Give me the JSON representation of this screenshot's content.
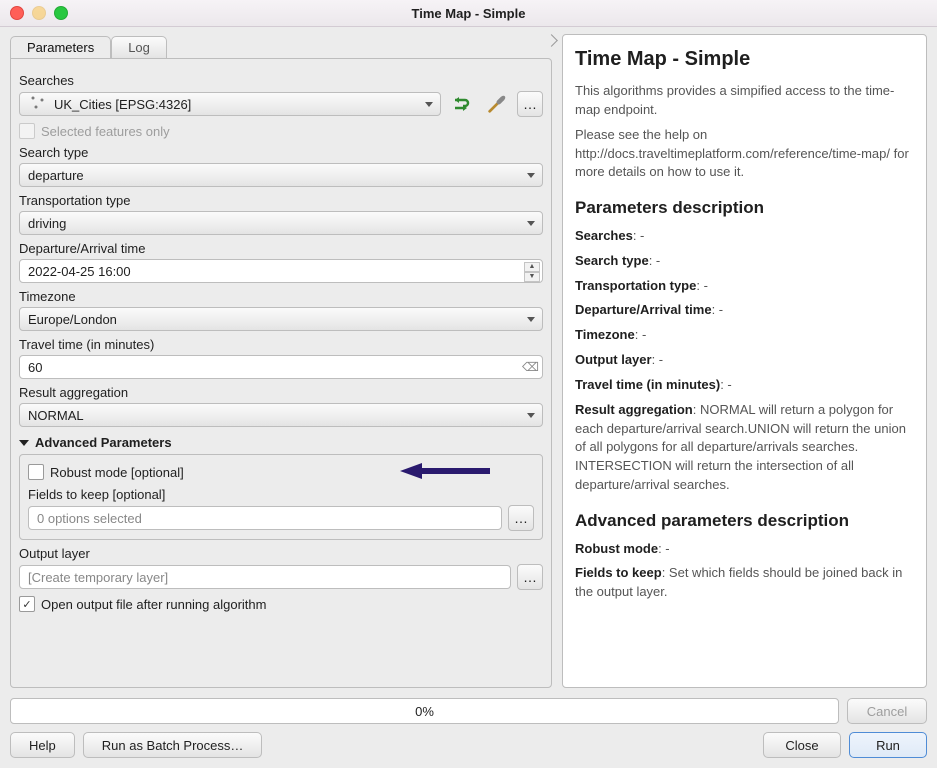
{
  "window": {
    "title": "Time Map - Simple"
  },
  "tabs": {
    "parameters": "Parameters",
    "log": "Log"
  },
  "fields": {
    "searches_label": "Searches",
    "searches_value": "UK_Cities [EPSG:4326]",
    "selected_only": "Selected features only",
    "search_type_label": "Search type",
    "search_type_value": "departure",
    "trans_type_label": "Transportation type",
    "trans_type_value": "driving",
    "dep_arr_label": "Departure/Arrival time",
    "dep_arr_value": "2022-04-25 16:00",
    "tz_label": "Timezone",
    "tz_value": "Europe/London",
    "travel_time_label": "Travel time (in minutes)",
    "travel_time_value": "60",
    "result_agg_label": "Result aggregation",
    "result_agg_value": "NORMAL",
    "advanced_header": "Advanced Parameters",
    "robust_mode": "Robust mode [optional]",
    "fields_keep_label": "Fields to keep [optional]",
    "fields_keep_placeholder": "0 options selected",
    "output_layer_label": "Output layer",
    "output_layer_placeholder": "[Create temporary layer]",
    "open_after": "Open output file after running algorithm",
    "ellipsis": "…"
  },
  "progress": {
    "text": "0%",
    "cancel": "Cancel"
  },
  "buttons": {
    "help": "Help",
    "batch": "Run as Batch Process…",
    "close": "Close",
    "run": "Run"
  },
  "help": {
    "title": "Time Map - Simple",
    "p1": "This algorithms provides a simpified access to the time-map endpoint.",
    "p2": "Please see the help on http://docs.traveltimeplatform.com/reference/time-map/ for more details on how to use it.",
    "h_params": "Parameters description",
    "searches": "Searches",
    "search_type": "Search type",
    "trans_type": "Transportation type",
    "dep_arr": "Departure/Arrival time",
    "tz": "Timezone",
    "output_layer": "Output layer",
    "travel_time": "Travel time (in minutes)",
    "result_agg": "Result aggregation",
    "result_agg_desc": ": NORMAL will return a polygon for each departure/arrival search.UNION will return the union of all polygons for all departure/arrivals searches. INTERSECTION will return the intersection of all departure/arrival searches.",
    "h_adv": "Advanced parameters description",
    "robust": "Robust mode",
    "fields_keep": "Fields to keep",
    "fields_keep_desc": ": Set which fields should be joined back in the output layer.",
    "dash": ": -"
  }
}
